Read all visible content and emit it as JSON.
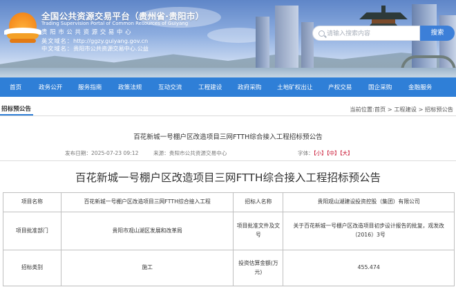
{
  "header": {
    "title": "全国公共资源交易平台（贵州省·贵阳市）",
    "subtitle_en": "Trading Supervision Portal of Common Resources of Guiyang",
    "subtitle_cn": "贵阳市公共资源交易中心",
    "domain_en_label": "英文域名：",
    "domain_en_value": "http://ggzy.guiyang.gov.cn",
    "domain_cn_label": "中文域名：",
    "domain_cn_value": "贵阳市公共资源交易中心.公益",
    "search_placeholder": "请输入搜索内容",
    "search_button": "搜索"
  },
  "nav": [
    "首页",
    "政务公开",
    "服务指南",
    "政策法规",
    "互动交流",
    "工程建设",
    "政府采购",
    "土地矿权出让",
    "产权交易",
    "国企采购",
    "金融服务"
  ],
  "breadcrumb": {
    "section_title": "招标预公告",
    "path": "当前位置:首页 > 工程建设 > 招标预公告"
  },
  "article": {
    "head_title": "百花新城一号棚户区改造项目三网FTTH综合接入工程招标预公告",
    "publish_date": "发布日期：2025-07-23 09:12",
    "source": "来源：贵阳市公共资源交易中心",
    "font_label": "字体：",
    "font_small": "【小】",
    "font_medium": "【中】",
    "font_large": "【大】",
    "main_title": "百花新城一号棚户区改造项目三网FTTH综合接入工程招标预公告"
  },
  "table": {
    "rows": [
      [
        "项目名称",
        "百花新城一号棚户区改造项目三网FTTH综合接入工程",
        "招标人名称",
        "贵阳观山湖建设投资控股（集团）有限公司"
      ],
      [
        "项目批准部门",
        "贵阳市观山湖区发展和改革局",
        "项目批准文件及文号",
        "关于百花新城一号棚户区改造项目初步设计报告的批复，观发改（2016）3号"
      ],
      [
        "招标类别",
        "施工",
        "投资估算金额(万元)",
        "455.474"
      ]
    ]
  },
  "colors": {
    "nav_bg": "#2f7fd7",
    "search_button": "#3c7fd8",
    "font_active": "#c8102e"
  }
}
